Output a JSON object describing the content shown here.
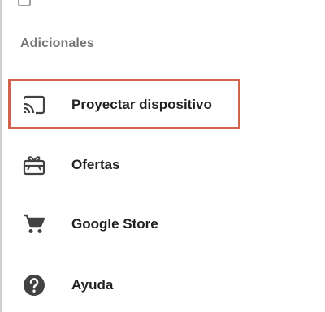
{
  "section": {
    "title": "Adicionales"
  },
  "items": [
    {
      "label": "Proyectar dispositivo",
      "icon": "cast-icon",
      "highlighted": true
    },
    {
      "label": "Ofertas",
      "icon": "gift-card-icon",
      "highlighted": false
    },
    {
      "label": "Google Store",
      "icon": "shopping-cart-icon",
      "highlighted": false
    },
    {
      "label": "Ayuda",
      "icon": "help-icon",
      "highlighted": false
    }
  ],
  "colors": {
    "highlight": "#d0644c",
    "icon": "#424242",
    "label": "#212121",
    "section_title": "#757575"
  }
}
